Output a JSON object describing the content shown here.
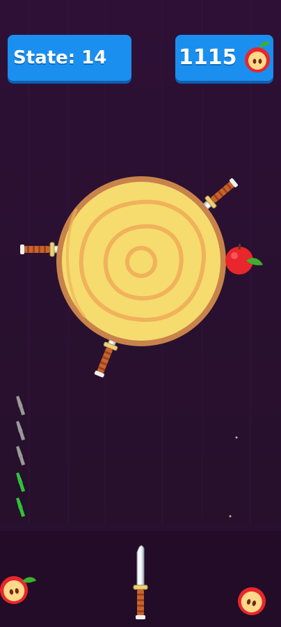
{
  "hud": {
    "state_label": "State: 14",
    "apple_score": "1115",
    "apple_icon": "apple-half-icon"
  },
  "game": {
    "knives_remaining": 5,
    "knives_used": 3,
    "knives_stuck_in_log": 3,
    "apples_on_log": 1
  },
  "colors": {
    "background": "#2a0f33",
    "hud_button": "#1a8ff0",
    "log_wood": "#f6db6e",
    "log_bark": "#c8834a",
    "apple": "#e8262b",
    "knife_used": "#2ec43a",
    "knife_left": "#9a9a9a"
  }
}
